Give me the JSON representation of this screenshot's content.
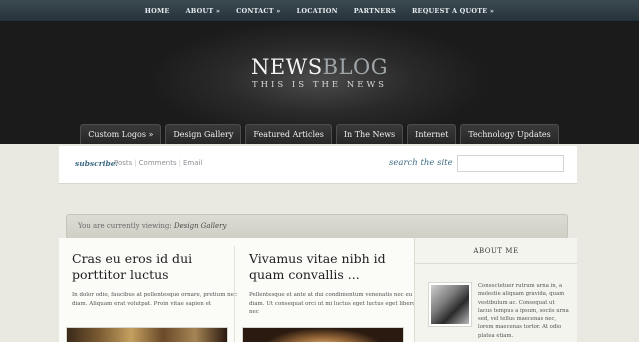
{
  "topnav": {
    "items": [
      "HOME",
      "ABOUT »",
      "CONTACT »",
      "LOCATION",
      "PARTNERS",
      "REQUEST A QUOTE »"
    ]
  },
  "logo": {
    "news": "NEWS",
    "blog": "BLOG",
    "tagline": "THIS IS THE NEWS"
  },
  "catnav": {
    "items": [
      "Custom Logos »",
      "Design Gallery",
      "Featured Articles",
      "In The News",
      "Internet",
      "Technology Updates"
    ]
  },
  "subscribe": {
    "label": "subscribe:",
    "posts": "Posts",
    "sep": "|",
    "comments": "Comments",
    "email": "Email"
  },
  "search": {
    "label": "search the site",
    "value": ""
  },
  "breadcrumb": {
    "prefix": "You are currently viewing:",
    "current": "Design Gallery"
  },
  "posts": [
    {
      "title": "Cras eu eros id dui porttitor luctus",
      "excerpt": "In dolor odio, faucibus at pellentesque ornare, pretium nec diam. Aliquam erat volutpat. Proin vitae sapien et"
    },
    {
      "title": "Vivamus vitae nibh id quam convallis ...",
      "excerpt": "Pellentesque et ante at dui condimentum venenatis nec eu diam. Ut consequat orci ut mi luctus eget luctus eget libero nec"
    }
  ],
  "sidebar": {
    "heading": "ABOUT ME",
    "about": "Consectetuer rutrum urna in, a molestie aliquam gravida, quam vestibulum ac. Consequat ut lacus tempus a ipsum, sociis urna sed, vel tellus maecenas nec, lorem maecenas tortor. At odio platea etiam."
  },
  "colors": {
    "accent": "#3d6b84",
    "header_bg": "#1b1b1b",
    "page_bg": "#e9e9e2"
  }
}
